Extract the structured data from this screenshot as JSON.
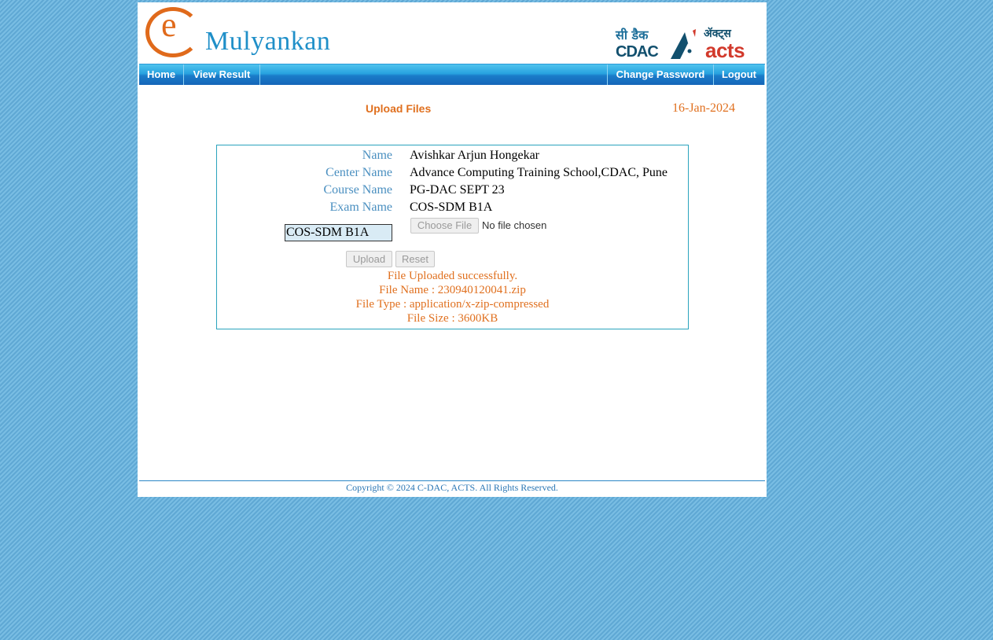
{
  "brand": {
    "logo_letter": "e",
    "logo_word": "Mulyankan",
    "cdac_hindi": "सी डैक",
    "cdac_english": "CDAC",
    "acts_hindi": "ॲक्ट्स",
    "acts_english": "acts"
  },
  "nav": {
    "home": "Home",
    "view_result": "View Result",
    "change_password": "Change Password",
    "logout": "Logout"
  },
  "page": {
    "title": "Upload Files",
    "date": "16-Jan-2024"
  },
  "form": {
    "name_label": "Name",
    "name_value": "Avishkar Arjun Hongekar",
    "center_label": "Center Name",
    "center_value": "Advance Computing Training School,CDAC, Pune",
    "course_label": "Course Name",
    "course_value": "PG-DAC SEPT 23",
    "exam_label": "Exam Name",
    "exam_value": "COS-SDM B1A",
    "exam_input_value": "COS-SDM B1A",
    "choose_file_label": "Choose File",
    "file_status": "No file chosen",
    "upload_label": "Upload",
    "reset_label": "Reset"
  },
  "result": {
    "line1": "File Uploaded successfully.",
    "line2": "File Name : 230940120041.zip",
    "line3": "File Type : application/x-zip-compressed",
    "line4": "File Size : 3600KB"
  },
  "footer": {
    "copyright": "Copyright © 2024 C-DAC, ACTS. All Rights Reserved."
  },
  "colors": {
    "accent_orange": "#e0701f",
    "label_blue": "#4a8fc0",
    "nav_blue": "#1a7cc9",
    "border_teal": "#2aa3bd"
  }
}
